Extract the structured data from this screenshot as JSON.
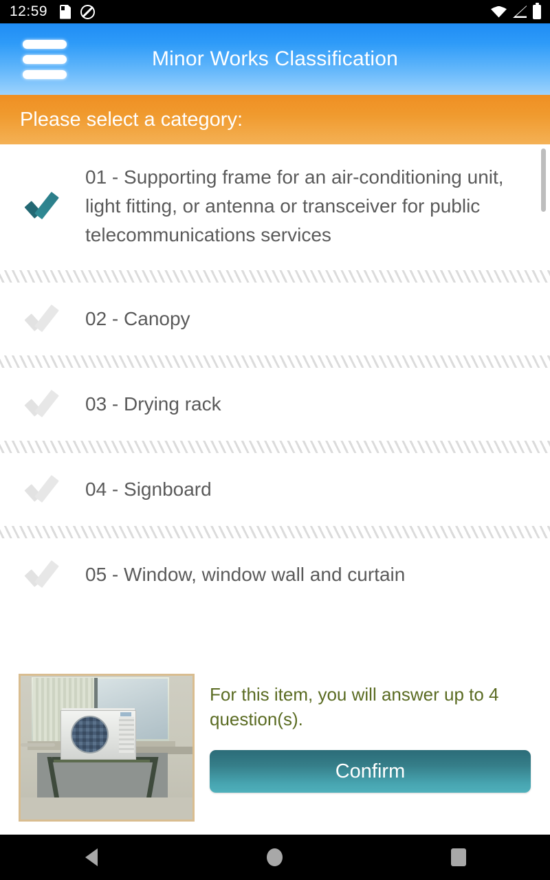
{
  "status_bar": {
    "time": "12:59",
    "icons_left": [
      "sd-card-icon",
      "do-not-disturb-icon"
    ],
    "icons_right": [
      "wifi-icon",
      "cellular-signal-icon",
      "battery-icon"
    ]
  },
  "app_bar": {
    "title": "Minor Works Classification",
    "menu_icon": "hamburger-menu-icon",
    "background_top": "#1f8cf5",
    "background_bottom": "#9ed3fd"
  },
  "prompt_bar": {
    "text": "Please select a category:",
    "background_top": "#ef8f23",
    "background_bottom": "#f4b155"
  },
  "categories": [
    {
      "label": "01 - Supporting frame for an air-conditioning unit, light fitting, or antenna or transceiver for public telecommunications services",
      "selected": true
    },
    {
      "label": "02 - Canopy",
      "selected": false
    },
    {
      "label": "03 - Drying rack",
      "selected": false
    },
    {
      "label": "04 - Signboard",
      "selected": false
    },
    {
      "label": "05 - Window, window wall and curtain",
      "selected": false
    }
  ],
  "colors": {
    "check_selected": "#2b7d89",
    "check_unselected": "#e4e4e4",
    "item_text": "#5a5a5a",
    "info_text": "#5a6b22",
    "confirm_top": "#2b6c78",
    "confirm_bottom": "#4fb0bb",
    "thumb_border": "#d9bd90"
  },
  "footer": {
    "thumbnail_alt": "air-conditioning outdoor unit on supporting frame beside window",
    "info_text": "For this item, you will answer up to 4 question(s).",
    "confirm_label": "Confirm"
  },
  "nav_bar": {
    "back": "back-triangle-icon",
    "home": "home-circle-icon",
    "recents": "recents-square-icon"
  }
}
